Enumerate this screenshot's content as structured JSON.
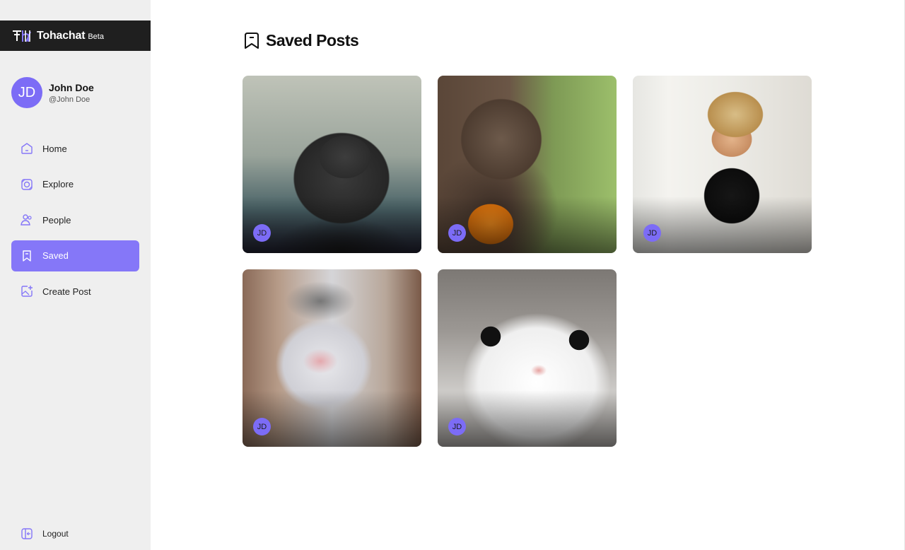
{
  "brand": {
    "name": "Tohachat",
    "badge": "Beta"
  },
  "user": {
    "initials": "JD",
    "name": "John Doe",
    "handle": "@John Doe"
  },
  "nav": {
    "items": [
      {
        "label": "Home",
        "icon": "home-icon",
        "active": false
      },
      {
        "label": "Explore",
        "icon": "explore-icon",
        "active": false
      },
      {
        "label": "People",
        "icon": "people-icon",
        "active": false
      },
      {
        "label": "Saved",
        "icon": "bookmark-icon",
        "active": true
      },
      {
        "label": "Create Post",
        "icon": "image-add-icon",
        "active": false
      }
    ],
    "logout_label": "Logout"
  },
  "page": {
    "title": "Saved Posts",
    "icon": "bookmark-icon"
  },
  "posts": [
    {
      "author_initials": "JD",
      "image": "chimpanzee-photo"
    },
    {
      "author_initials": "JD",
      "image": "monkey-holding-orange-photo"
    },
    {
      "author_initials": "JD",
      "image": "cat-with-wig-photo"
    },
    {
      "author_initials": "JD",
      "image": "blurry-kitten-photo"
    },
    {
      "author_initials": "JD",
      "image": "cute-kitten-photo"
    }
  ],
  "colors": {
    "accent": "#8577f8",
    "avatar": "#7c6cf6",
    "sidebar_bg": "#efefef",
    "brand_bar": "#1f1f1f"
  }
}
